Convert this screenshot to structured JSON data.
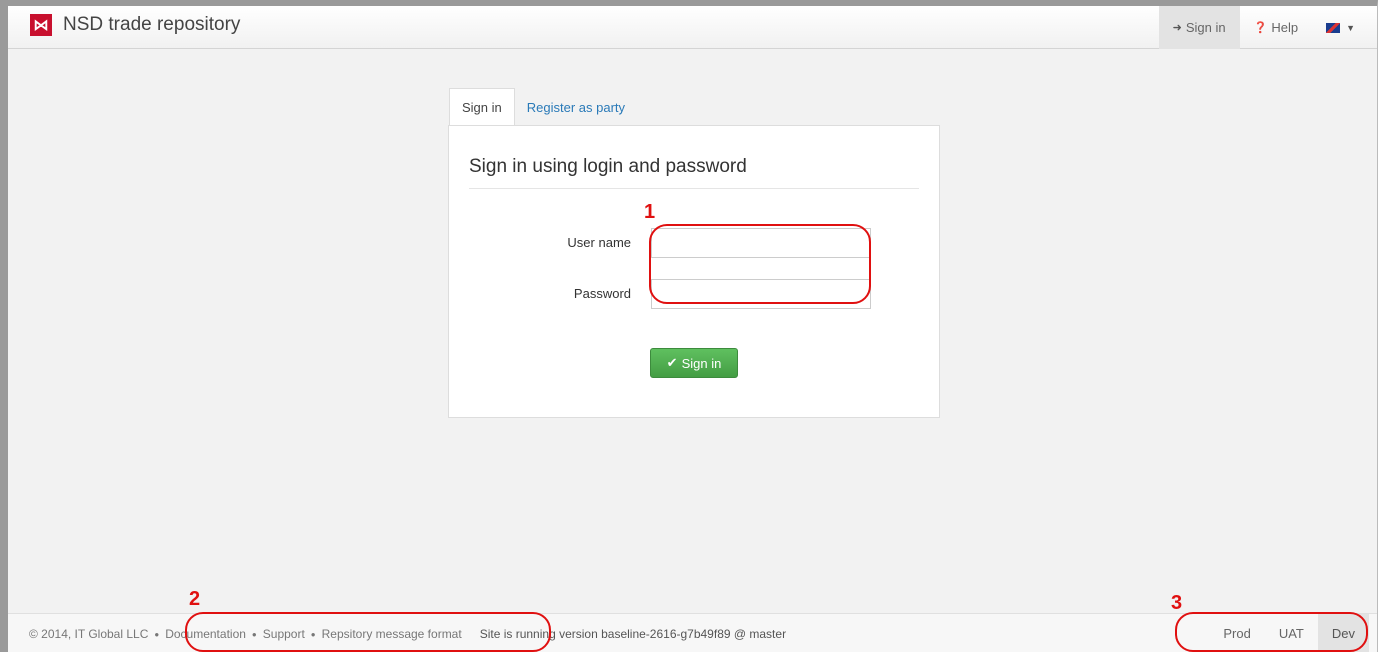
{
  "navbar": {
    "brand_logo": "⋈",
    "brand_title": "NSD trade repository",
    "signin_label": "Sign in",
    "help_label": "Help"
  },
  "tabs": [
    {
      "label": "Sign in"
    },
    {
      "label": "Register as party"
    }
  ],
  "form": {
    "title": "Sign in using login and password",
    "username_label": "User name",
    "username_value": "",
    "password_label": "Password",
    "password_value": "",
    "submit_label": "Sign in"
  },
  "footer": {
    "copyright": "© 2014, IT Global LLC",
    "links": [
      "Documentation",
      "Support",
      "Repsitory message format"
    ],
    "version": "Site is running version baseline-2616-g7b49f89 @ master",
    "environments": [
      "Prod",
      "UAT",
      "Dev"
    ]
  },
  "annotations": [
    "1",
    "2",
    "3"
  ],
  "colors": {
    "brand": "#c8102e",
    "link": "#2a7ab8",
    "success": "#449d44",
    "annotation": "#e01010"
  }
}
